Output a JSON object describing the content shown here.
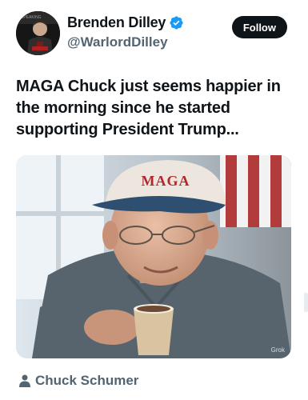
{
  "author": {
    "display_name": "Brenden Dilley",
    "handle": "@WarlordDilley",
    "verified_icon": "verified-badge-icon",
    "avatar_icon": "avatar-image"
  },
  "follow_label": "Follow",
  "tweet": {
    "text": "MAGA Chuck just seems happier in the morning since he started supporting President Trump..."
  },
  "media": {
    "cap_text": "MAGA",
    "watermark": "Grok"
  },
  "tag": {
    "icon": "person-icon",
    "label": "Chuck Schumer"
  },
  "colors": {
    "accent_verified": "#1d9bf0",
    "follow_bg": "#0f1419",
    "secondary_text": "#536471"
  }
}
